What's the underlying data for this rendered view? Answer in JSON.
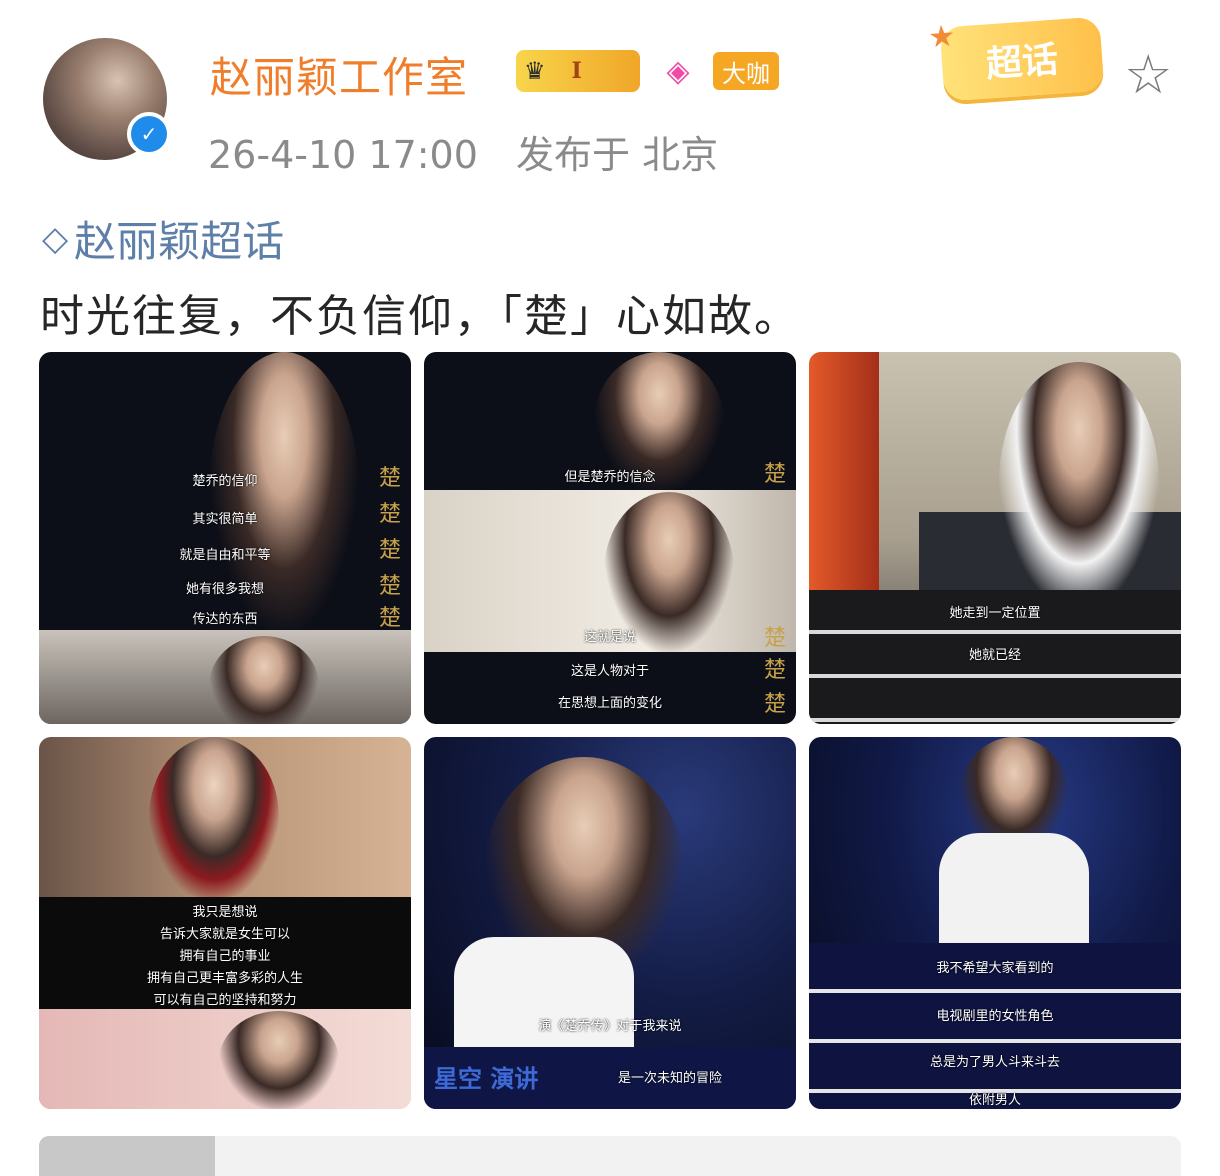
{
  "header": {
    "username": "赵丽颖工作室",
    "crown_level": "I",
    "dakai_label": "大咖",
    "timestamp": "26-4-10 17:00",
    "location": "发布于 北京",
    "chaohua_badge": "超话"
  },
  "post": {
    "topic": "赵丽颖超话",
    "text": "时光往复，不负信仰，「楚」心如故。"
  },
  "images": [
    {
      "subtitles": [
        "楚乔的信仰",
        "其实很简单",
        "就是自由和平等",
        "她有很多我想",
        "传达的东西"
      ],
      "logo_text": "楚"
    },
    {
      "subtitles": [
        "但是楚乔的信念",
        "这就是说",
        "这是人物对于",
        "在思想上面的变化"
      ],
      "logo_text": "楚"
    },
    {
      "subtitles": [
        "她走到一定位置",
        "她就已经"
      ]
    },
    {
      "subtitles": [
        "我只是想说",
        "告诉大家就是女生可以",
        "拥有自己的事业",
        "拥有自己更丰富多彩的人生",
        "可以有自己的坚持和努力"
      ]
    },
    {
      "subtitles": [
        "演《楚乔传》对于我来说",
        "是一次未知的冒险"
      ],
      "show_label": "星空 演讲"
    },
    {
      "subtitles": [
        "我不希望大家看到的",
        "电视剧里的女性角色",
        "总是为了男人斗来斗去",
        "依附男人"
      ]
    }
  ],
  "colors": {
    "username": "#f07d2a",
    "topic": "#5e7fa8",
    "meta": "#8a8a8a",
    "verified": "#1f8bea"
  },
  "icons": {
    "verified": "verified-icon",
    "crown": "crown-icon",
    "vip": "diamond-vip-icon",
    "favorite": "star-icon",
    "topic": "diamond-icon"
  }
}
